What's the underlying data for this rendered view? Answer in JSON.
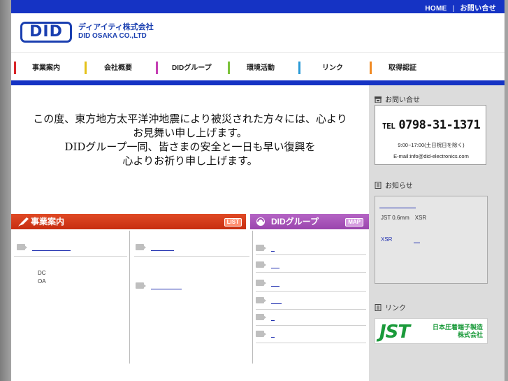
{
  "header": {
    "top_links": [
      "HOME",
      "お問い合せ"
    ],
    "top_sep": "|",
    "logo_text": "DID",
    "company_jp": "ディアイティ株式会社",
    "company_en": "DID OSAKA CO.,LTD"
  },
  "nav": {
    "items": [
      {
        "label": "事業案内",
        "color": "#d9262a"
      },
      {
        "label": "会社概要",
        "color": "#e5c21a"
      },
      {
        "label": "DIDグループ",
        "color": "#c53fb3"
      },
      {
        "label": "環境活動",
        "color": "#7cc23a"
      },
      {
        "label": "リンク",
        "color": "#2a9ad6"
      },
      {
        "label": "取得認証",
        "color": "#f08a24"
      }
    ]
  },
  "notice": {
    "lines": [
      "この度、東方地方太平洋沖地震により被災された方々には、心より",
      "お見舞い申し上げます。",
      "DIDグループ一同、皆さまの安全と一日も早い復興を",
      "心よりお祈り申し上げます。"
    ]
  },
  "business": {
    "title": "事業案内",
    "button": "LIST",
    "sub_text": [
      "DC",
      "OA"
    ]
  },
  "group": {
    "title": "DIDグループ",
    "button": "MAP"
  },
  "contact": {
    "heading": "お問い合せ",
    "tel_prefix": "TEL",
    "tel": "0798-31-1371",
    "hours": "9:00~17:00(土日祝日を除く)",
    "email": "E-mail:info@did-electronics.com"
  },
  "news": {
    "heading": "お知らせ",
    "line1": "JST 0.6mm　XSR",
    "line2": "XSR"
  },
  "links": {
    "heading": "リンク",
    "jst_logo": "JST",
    "jst_name_1": "日本圧着端子製造",
    "jst_name_2": "株式会社"
  },
  "colors": {
    "brand_blue": "#1533c4",
    "jst_green": "#1a9a3a"
  }
}
